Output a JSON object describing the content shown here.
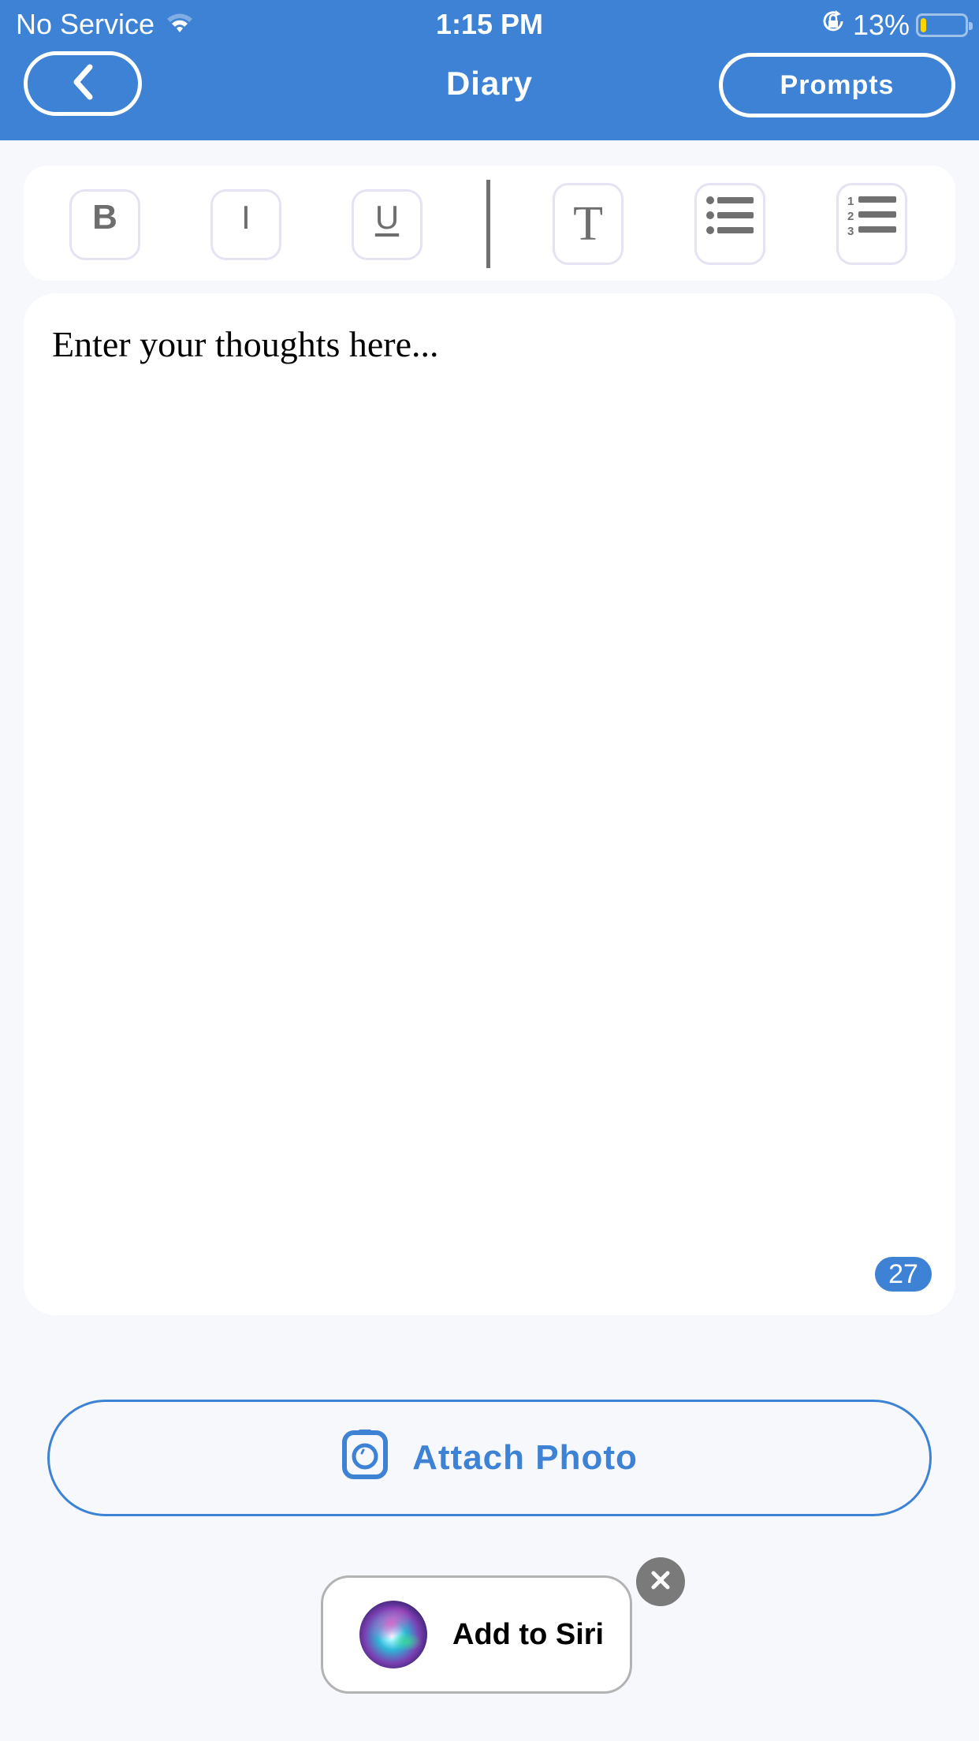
{
  "status_bar": {
    "carrier": "No Service",
    "time": "1:15 PM",
    "battery_percent_label": "13%",
    "battery_level": 0.13,
    "battery_color": "#ffd500",
    "icons": [
      "wifi-icon",
      "orientation-lock-icon",
      "battery-icon"
    ]
  },
  "header": {
    "title": "Diary",
    "back_icon": "chevron-left-icon",
    "prompts_label": "Prompts",
    "background_color": "#3d82d4"
  },
  "toolbar": {
    "items": [
      {
        "name": "bold",
        "glyph": "B"
      },
      {
        "name": "italic",
        "glyph": "I"
      },
      {
        "name": "underline",
        "glyph": "U"
      },
      {
        "name": "text-size",
        "glyph": "T"
      },
      {
        "name": "bullet-list",
        "glyph": "bullet-list-icon"
      },
      {
        "name": "numbered-list",
        "glyph": "numbered-list-icon"
      }
    ]
  },
  "editor": {
    "placeholder": "Enter your thoughts here...",
    "char_count": "27"
  },
  "attach": {
    "label": "Attach Photo",
    "icon": "camera-icon"
  },
  "siri": {
    "label": "Add to Siri",
    "icon": "siri-icon",
    "close_icon": "close-icon"
  }
}
